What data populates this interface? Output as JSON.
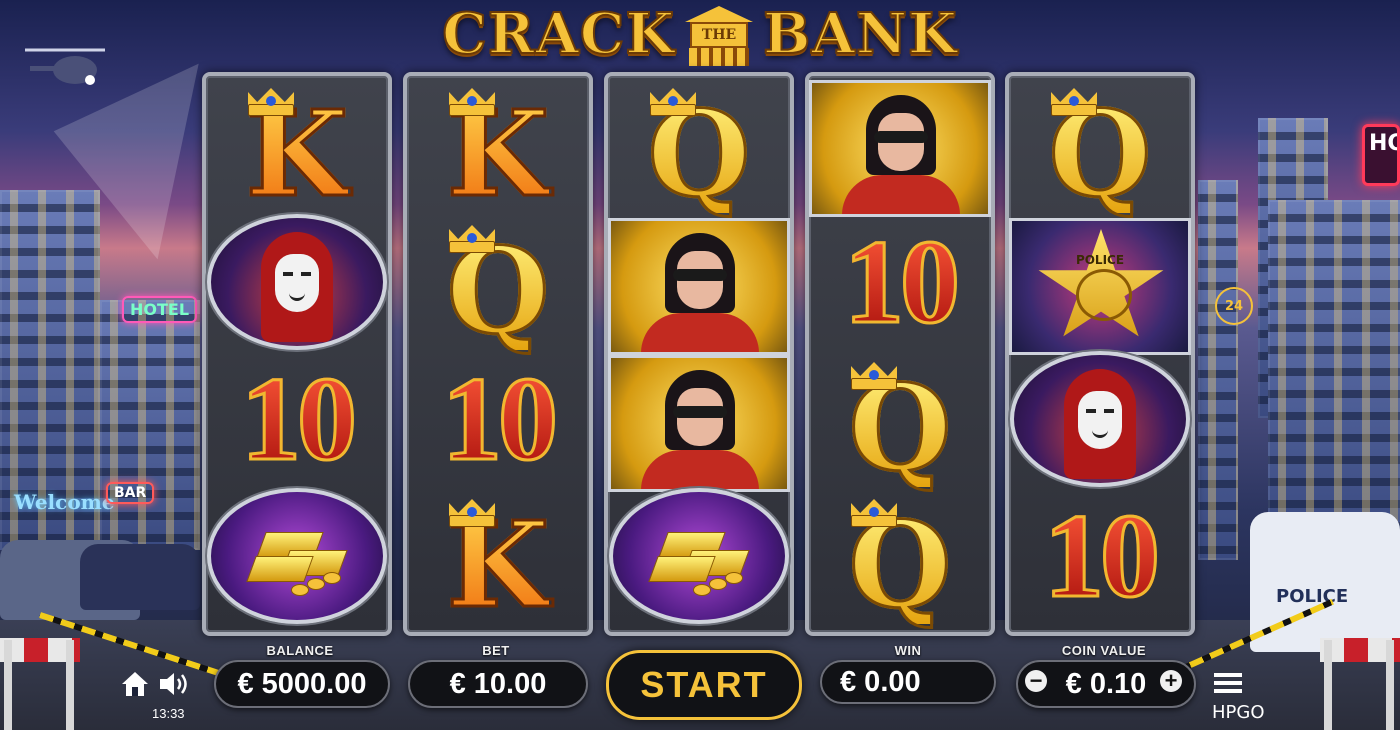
{
  "game": {
    "title_left": "CRACK",
    "title_middle": "THE",
    "title_right": "BANK",
    "brand": "HPGO",
    "clock": "13:33"
  },
  "reels": [
    [
      "K",
      "hacker",
      "10",
      "gold-bars"
    ],
    [
      "K",
      "Q",
      "10",
      "K"
    ],
    [
      "Q",
      "heist-woman",
      "heist-woman",
      "gold-bars"
    ],
    [
      "heist-woman",
      "10",
      "Q",
      "Q"
    ],
    [
      "Q",
      "police-badge",
      "hacker",
      "10"
    ]
  ],
  "symbol_text": {
    "police_badge": "POLICE"
  },
  "controls": {
    "balance_label": "BALANCE",
    "balance_value": "€ 5000.00",
    "bet_label": "BET",
    "bet_value": "€ 10.00",
    "start_label": "START",
    "win_label": "WIN",
    "win_value": "€ 0.00",
    "coin_label": "COIN VALUE",
    "coin_value": "€ 0.10",
    "minus": "−",
    "plus": "+"
  },
  "scenery_text": {
    "hotel_sign": "HOTEL",
    "welcome_sign": "Welcome",
    "bar_sign": "BAR",
    "hours_sign": "24",
    "car_sign": "POLICE",
    "ho_sign": "HO"
  },
  "colors": {
    "accent_gold": "#f5c23a",
    "panel_dark": "#111216"
  },
  "icons": [
    "home-icon",
    "sound-icon",
    "menu-icon",
    "minus-icon",
    "plus-icon"
  ]
}
